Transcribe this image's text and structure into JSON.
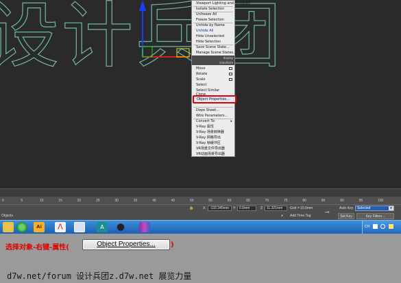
{
  "viewport": {
    "watermark_text": "设计兵团"
  },
  "quad_menu": {
    "top_items": [
      "Viewport Lighting and Shadows",
      "Isolate Selection",
      "Unfreeze All",
      "Freeze Selection",
      "Unhide by Name",
      "Unhide All",
      "Hide Unselected",
      "Hide Selection",
      "Save Scene State...",
      "Manage Scene States..."
    ],
    "display_header": "display",
    "transform_header": "transform",
    "transform_items": [
      "Move",
      "Rotate",
      "Scale",
      "Select",
      "Select Similar",
      "Clone"
    ],
    "highlighted_item": "Object Properties...",
    "bottom_items": [
      "Dope Sheet...",
      "Wire Parameters...",
      "Convert To:",
      "V-Ray 属性",
      "V-Ray 场景转换器",
      "V-Ray 网格导出",
      "V-Ray 帧缓冲区",
      "VR场景文件导出器",
      "VR动画场景导出器"
    ]
  },
  "timeline": {
    "ticks": [
      "0",
      "5",
      "10",
      "15",
      "20",
      "25",
      "30",
      "35",
      "40",
      "45",
      "50",
      "55",
      "60",
      "65",
      "70",
      "75",
      "80",
      "85",
      "90",
      "95",
      "100"
    ]
  },
  "status_bar": {
    "left_text": "Objects",
    "x_label": "X:",
    "x_value": "-132.345mm",
    "y_label": "Y:",
    "y_value": "0.0mm",
    "z_label": "Z:",
    "z_value": "11.321mm",
    "grid_text": "Grid = 10.0mm",
    "add_time_tag": "Add Time Tag",
    "auto_key": "Auto Key",
    "selected_value": "Selected",
    "set_key": "Set Key",
    "key_filters": "Key Filters..."
  },
  "taskbar": {
    "tray_text": "CH",
    "buttons": [
      "windows-explorer",
      "ie",
      "adobe-illustrator",
      "acrobat",
      "app-window",
      "acad",
      "qq",
      "winrar"
    ]
  },
  "caption": {
    "instruction": "选择对象-右键-属性(",
    "button_label": "Object Properties...",
    "close_paren": ")",
    "footer": "d7w.net/forum 设计兵团z.d7w.net 展览力量"
  },
  "colors": {
    "highlight_border": "#e00000",
    "caption_red": "#e00000",
    "watermark_outline": "#6fb8a5",
    "gizmo_blue": "#1a3cff",
    "gizmo_green": "#25d425"
  }
}
